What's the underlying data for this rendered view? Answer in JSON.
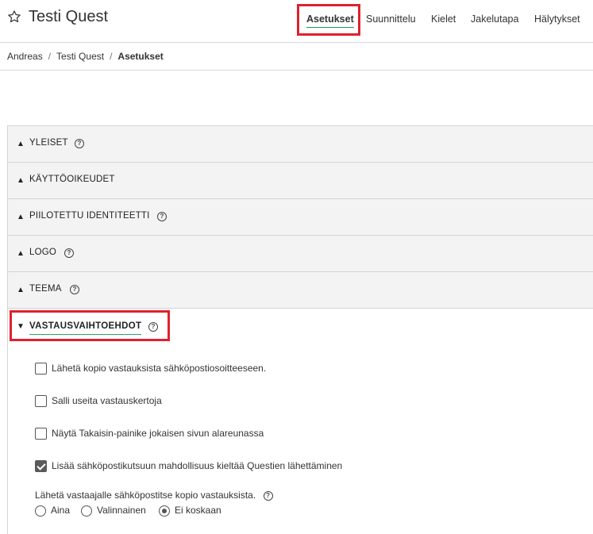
{
  "header": {
    "title": "Testi Quest",
    "nav": [
      {
        "label": "Asetukset",
        "active": true
      },
      {
        "label": "Suunnittelu"
      },
      {
        "label": "Kielet"
      },
      {
        "label": "Jakelutapa"
      },
      {
        "label": "Hälytykset"
      }
    ]
  },
  "breadcrumbs": [
    "Andreas",
    "Testi Quest",
    "Asetukset"
  ],
  "sections": [
    {
      "label": "YLEISET",
      "help": true
    },
    {
      "label": "KÄYTTÖOIKEUDET",
      "help": false
    },
    {
      "label": "PIILOTETTU IDENTITEETTI",
      "help": true
    },
    {
      "label": "LOGO",
      "help": true
    },
    {
      "label": "TEEMA",
      "help": true
    }
  ],
  "open_section": {
    "label": "VASTAUSVAIHTOEHDOT",
    "options": [
      {
        "label": "Lähetä kopio vastauksista sähköpostiosoitteeseen.",
        "checked": false
      },
      {
        "label": "Salli useita vastauskertoja",
        "checked": false
      },
      {
        "label": "Näytä Takaisin-painike jokaisen sivun alareunassa",
        "checked": false
      },
      {
        "label": "Lisää sähköpostikutsuun mahdollisuus kieltää Questien lähettäminen",
        "checked": true
      }
    ],
    "copy_question": "Lähetä vastaajalle sähköpostitse kopio vastauksista.",
    "copy_choices": [
      {
        "label": "Aina",
        "selected": false
      },
      {
        "label": "Valinnainen",
        "selected": false
      },
      {
        "label": "Ei koskaan",
        "selected": true
      }
    ]
  },
  "colors": {
    "highlight": "#e0212e",
    "accent": "#1f9a5a"
  },
  "icons": {
    "title": "star-outline-icon",
    "help": "question-circle-icon",
    "collapsed": "triangle-up-icon",
    "expanded": "triangle-down-icon"
  }
}
